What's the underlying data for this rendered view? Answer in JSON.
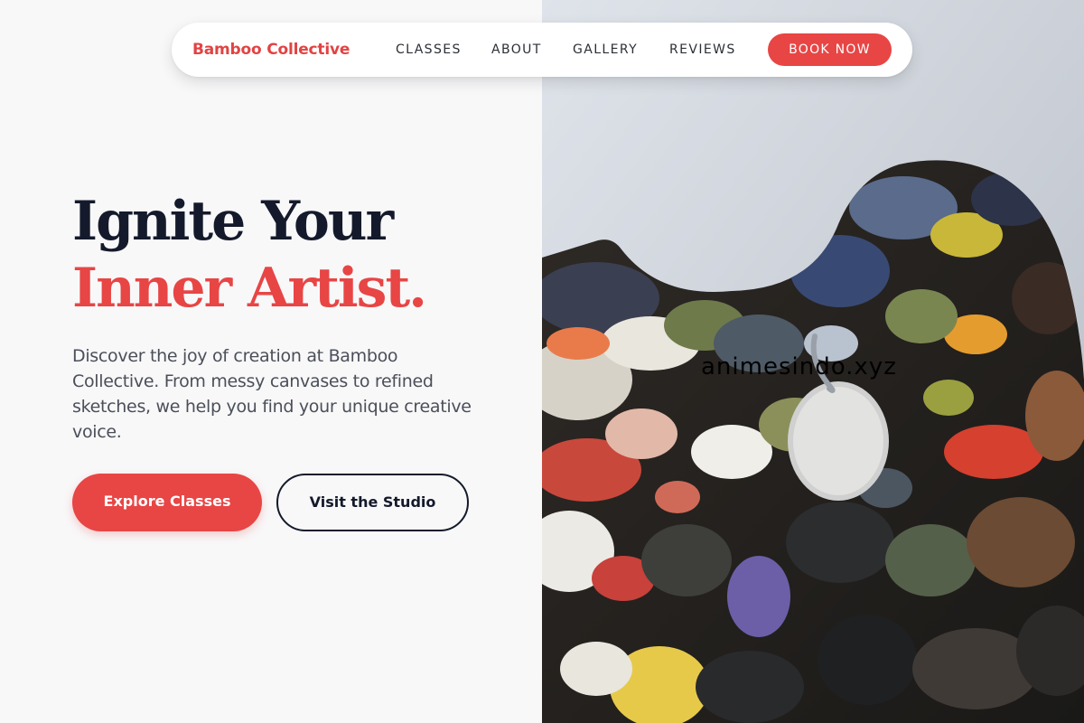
{
  "brand": {
    "name": "Bamboo Collective",
    "accent_color": "#e84545"
  },
  "nav": {
    "links": [
      "CLASSES",
      "ABOUT",
      "GALLERY",
      "REVIEWS"
    ],
    "cta_label": "BOOK NOW"
  },
  "hero": {
    "headline_line1": "Ignite Your",
    "headline_line2": "Inner Artist.",
    "subtitle": "Discover the joy of creation at Bamboo Collective. From messy canvases to refined sketches, we help you find your unique creative voice.",
    "primary_button": "Explore Classes",
    "secondary_button": "Visit the Studio"
  },
  "image": {
    "subject": "paint-palette-photo",
    "watermark_text": "animesindo.xyz"
  },
  "colors": {
    "headline_dark": "#141a2b",
    "page_background": "#f8f8f9",
    "body_text": "#4b4f59"
  }
}
